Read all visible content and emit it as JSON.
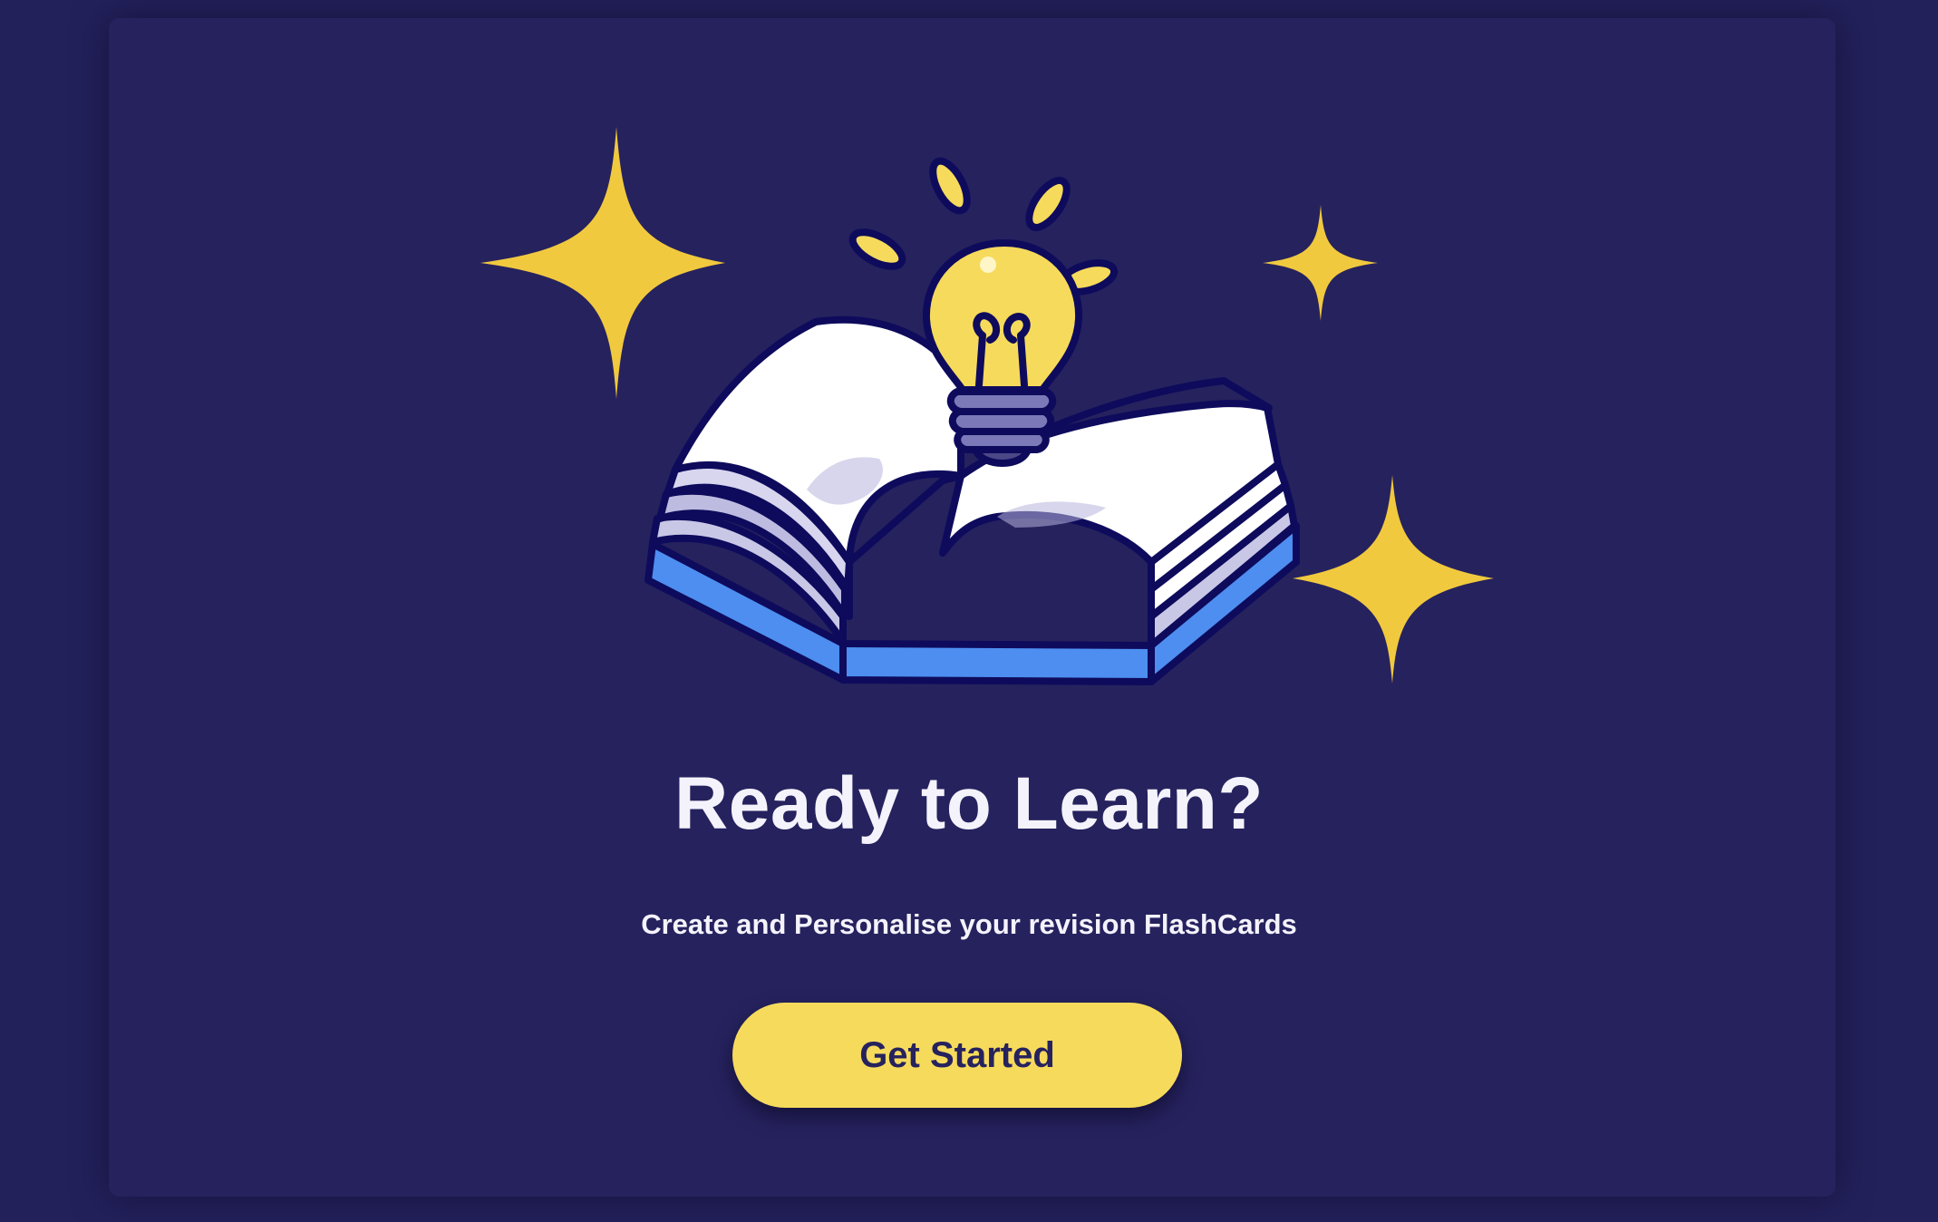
{
  "hero": {
    "title": "Ready to Learn?",
    "subtitle": "Create and Personalise your revision FlashCards",
    "cta_label": "Get Started"
  },
  "illustration": {
    "icons": [
      "sparkle-icon",
      "lightbulb-icon",
      "open-book-icon"
    ]
  },
  "colors": {
    "page_background": "#23215a",
    "card_background": "#26225e",
    "accent_yellow": "#f6da5c",
    "sparkle_yellow": "#f1c93e",
    "book_blue": "#4d8ef0",
    "outline_navy": "#0e0b5c",
    "text_light": "#f4f3fb"
  }
}
